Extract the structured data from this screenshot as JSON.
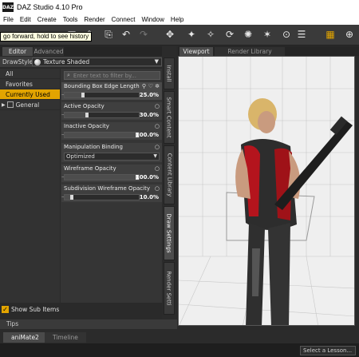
{
  "app": {
    "title": "DAZ Studio 4.10 Pro",
    "logo": "DAZ"
  },
  "menu": [
    "File",
    "Edit",
    "Create",
    "Tools",
    "Render",
    "Connect",
    "Window",
    "Help"
  ],
  "tooltip": "go forward, hold to see history",
  "pane_tabs": [
    "Editor",
    "Advanced"
  ],
  "drawstyle": {
    "label": "DrawStyle :",
    "value": "Texture Shaded"
  },
  "categories": [
    "All",
    "Favorites",
    "Currently Used",
    "General"
  ],
  "filter_placeholder": "Enter text to filter by...",
  "properties": [
    {
      "label": "Bounding Box Edge Length",
      "value": "25.0%",
      "level": 0.25
    },
    {
      "label": "Active Opacity",
      "value": "30.0%",
      "level": 0.3
    },
    {
      "label": "Inactive Opacity",
      "value": "100.0%",
      "level": 1.0
    },
    {
      "label": "Manipulation Binding",
      "value": "Optimized"
    },
    {
      "label": "Wireframe Opacity",
      "value": "100.0%",
      "level": 1.0
    },
    {
      "label": "Subdivision Wireframe Opacity",
      "value": "10.0%",
      "level": 0.1
    }
  ],
  "show_sub_items": "Show Sub Items",
  "side_tabs": [
    "Install",
    "Smart Content",
    "Content Library",
    "Draw Settings",
    "Render Setti"
  ],
  "viewport_tabs": [
    "Viewport",
    "Render Library"
  ],
  "bottom_tabs": [
    "aniMate2",
    "Timeline"
  ],
  "tips": "Tips",
  "lesson": "Select a Lesson...",
  "colors": {
    "accent": "#e2a400",
    "panel": "#353535",
    "viewport_bg": "#ededed"
  }
}
